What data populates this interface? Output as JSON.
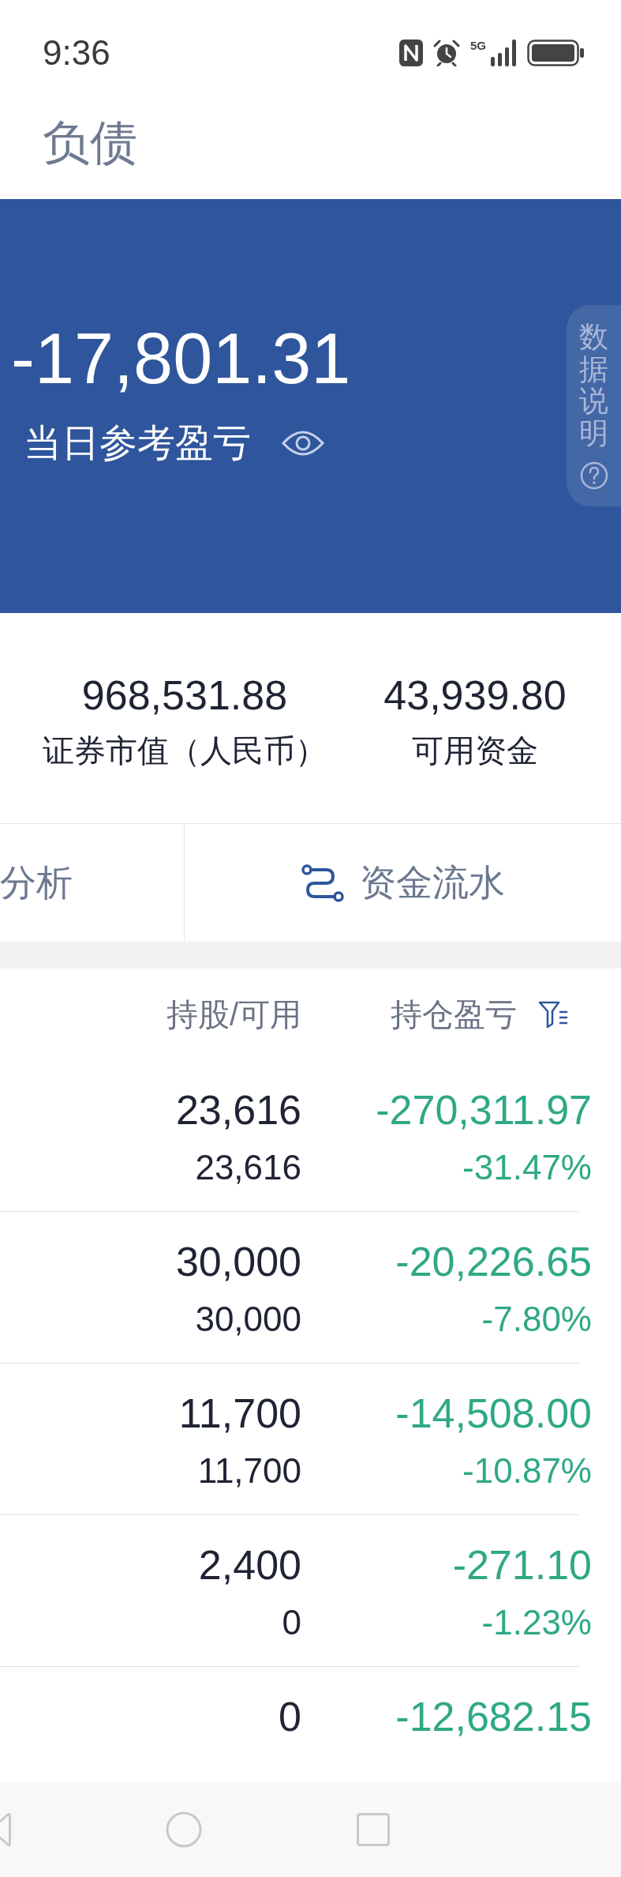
{
  "status_bar": {
    "time": "9:36",
    "network": "5G"
  },
  "header": {
    "title": "负债"
  },
  "banner": {
    "value": "-17,801.31",
    "label": "当日参考盈亏",
    "side_tab": "数据说明"
  },
  "stats": [
    {
      "value": "968,531.88",
      "label": "证券市值（人民币）"
    },
    {
      "value": "43,939.80",
      "label": "可用资金"
    }
  ],
  "actions": [
    {
      "label": "分析",
      "kind": "plain"
    },
    {
      "label": "资金流水",
      "kind": "flow"
    }
  ],
  "table": {
    "columns": [
      {
        "label": "持股/可用",
        "filter": false
      },
      {
        "label": "持仓盈亏",
        "filter": true
      }
    ],
    "rows": [
      {
        "holding": "23,616",
        "available": "23,616",
        "pnl": "-270,311.97",
        "pnl_ratio": "-31.47%",
        "loss": true
      },
      {
        "holding": "30,000",
        "available": "30,000",
        "pnl": "-20,226.65",
        "pnl_ratio": "-7.80%",
        "loss": true
      },
      {
        "holding": "11,700",
        "available": "11,700",
        "pnl": "-14,508.00",
        "pnl_ratio": "-10.87%",
        "loss": true
      },
      {
        "holding": "2,400",
        "available": "0",
        "pnl": "-271.10",
        "pnl_ratio": "-1.23%",
        "loss": true
      },
      {
        "holding": "0",
        "pnl": "-12,682.15",
        "loss": true
      }
    ]
  }
}
